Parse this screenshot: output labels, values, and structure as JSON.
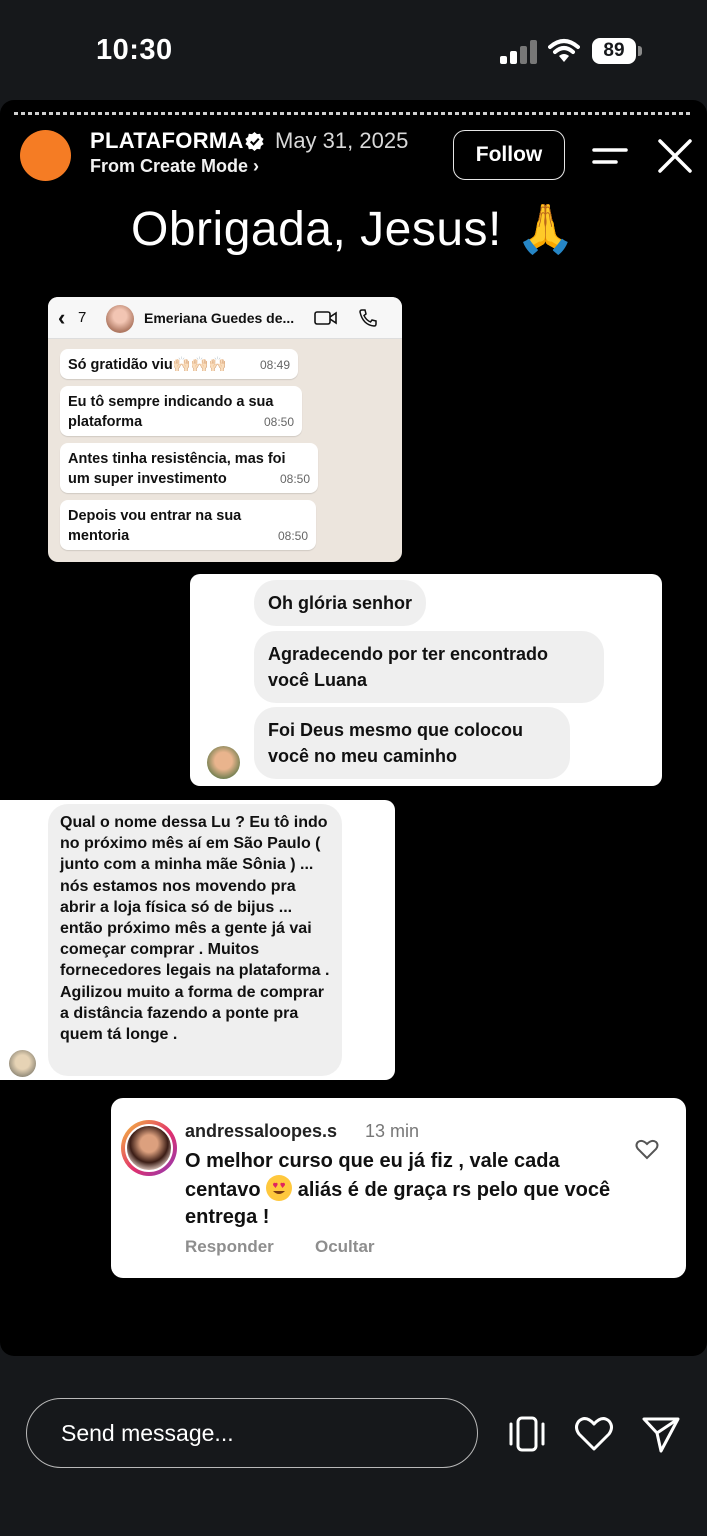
{
  "status_bar": {
    "time": "10:30",
    "battery": "89"
  },
  "header": {
    "account": "PLATAFORMA",
    "date": "May 31, 2025",
    "mode": "From Create Mode ›",
    "follow_label": "Follow"
  },
  "headline": "Obrigada, Jesus! 🙏",
  "whatsapp": {
    "back_count": "7",
    "contact_name": "Emeriana Guedes de...",
    "messages": [
      {
        "text": "Só gratidão viu🙌🏻🙌🏻🙌🏻",
        "time": "08:49"
      },
      {
        "text": "Eu tô sempre indicando a sua plataforma",
        "time": "08:50"
      },
      {
        "text": "Antes tinha resistência, mas foi um super investimento",
        "time": "08:50"
      },
      {
        "text": "Depois vou entrar na sua mentoria",
        "time": "08:50"
      }
    ]
  },
  "dm1": {
    "messages": [
      "Oh glória senhor",
      "Agradecendo por ter encontrado você Luana",
      "Foi Deus mesmo que colocou você no meu caminho"
    ]
  },
  "dm2": {
    "message": "Qual o nome dessa Lu ? Eu tô indo no próximo mês aí em São Paulo ( junto com a minha mãe Sônia ) ... nós estamos nos movendo pra abrir a loja física só de bijus ... então próximo mês a gente já vai começar comprar . Muitos fornecedores legais na plataforma . Agilizou muito a forma de comprar a distância fazendo a ponte pra quem tá longe ."
  },
  "comment": {
    "username": "andressaloopes.s",
    "time": "13 min",
    "text_before": "O melhor curso que eu já fiz , vale cada centavo",
    "emoji": "😍",
    "text_after": "aliás é de graça rs pelo que você entrega !",
    "reply_label": "Responder",
    "hide_label": "Ocultar"
  },
  "footer": {
    "placeholder": "Send message..."
  },
  "colors": {
    "brand_avatar": "#f57c24",
    "background": "#16181b",
    "story_bg": "#000000"
  }
}
